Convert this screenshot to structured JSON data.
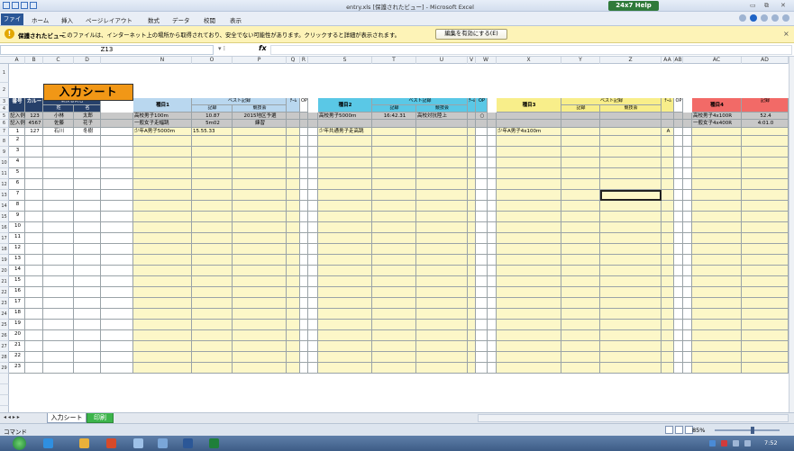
{
  "window": {
    "title": "entry.xls [保護されたビュー] - Microsoft Excel",
    "help_button": "24x7 Help",
    "ctl_min": "▭",
    "ctl_max": "⧉",
    "ctl_close": "✕"
  },
  "ribbon": {
    "file_tab": "ファイル",
    "tabs": [
      "ホーム",
      "挿入",
      "ページレイアウト",
      "数式",
      "データ",
      "校閲",
      "表示"
    ]
  },
  "infobar": {
    "title": "保護されたビュー",
    "message": "このファイルは、インターネット上の場所から取得されており、安全でない可能性があります。クリックすると詳細が表示されます。",
    "button": "編集を有効にする(E)",
    "close": "×"
  },
  "formula_bar": {
    "name_box": "Z13",
    "fx": "fx",
    "value": ""
  },
  "sheet": {
    "columns": [
      "A",
      "B",
      "C",
      "D",
      "N",
      "O",
      "P",
      "Q",
      "R",
      "S",
      "T",
      "U",
      "V",
      "W",
      "X",
      "Y",
      "Z",
      "AA",
      "AB",
      "AC",
      "AD"
    ],
    "rows": [
      "1",
      "2",
      "3",
      "4",
      "5",
      "6",
      "7",
      "8",
      "9",
      "10",
      "11",
      "12",
      "13",
      "14",
      "15",
      "16",
      "17",
      "18",
      "19",
      "20",
      "21",
      "22",
      "23",
      "24",
      "25",
      "26",
      "27",
      "28",
      "29"
    ],
    "title": "入力シート",
    "header": {
      "no": "番号",
      "card": "カルー",
      "name_top": "競技者氏名",
      "sei": "姓",
      "mei": "名",
      "event1": "種目1",
      "event2": "種目2",
      "event3": "種目3",
      "event4": "種目4",
      "best": "ベスト記録",
      "record": "記録",
      "meet": "競技会",
      "team": "ﾁｰﾑ",
      "op": "OP"
    },
    "example_rows": [
      {
        "no": "記入例",
        "card": "123",
        "sei": "小林",
        "mei": "太郎",
        "e1": "高校男子100m",
        "r1": "10.87",
        "m1": "2015地区予選",
        "e2": "高校男子5000m",
        "r2": "16:42.31",
        "m2": "高校対抗陸上",
        "w": "○",
        "e4": "高校男子4x100R",
        "r4": "52.4"
      },
      {
        "no": "記入例",
        "card": "4567",
        "sei": "佐藤",
        "mei": "花子",
        "e1": "一般女子走幅跳",
        "r1": "5m02",
        "m1": "練習",
        "e2": "",
        "r2": "",
        "m2": "",
        "w": "",
        "e4": "一般女子4x400R",
        "r4": "4:01.0"
      },
      {
        "no": "1",
        "card": "127",
        "sei": "石川",
        "mei": "冬樹",
        "e1": "少年A男子5000m",
        "r1": "15.55.33",
        "m1": "",
        "e2": "少年共通男子走高跳",
        "r2": "",
        "m2": "",
        "x": "少年A男子4x100m",
        "aa": "A",
        "e4": "",
        "r4": ""
      }
    ],
    "numbers": [
      "2",
      "3",
      "4",
      "5",
      "6",
      "7",
      "8",
      "9",
      "10",
      "11",
      "12",
      "13",
      "14",
      "15",
      "16",
      "17",
      "18",
      "19",
      "20",
      "21",
      "22",
      "23"
    ]
  },
  "tabs": {
    "sheet1": "入力シート",
    "sheet2": "印刷",
    "nav": "◂ ◂ ▸ ▸"
  },
  "status": {
    "mode": "コマンド",
    "zoom": "85%"
  },
  "taskbar": {
    "clock": "7:52"
  },
  "colors": {
    "event1": "#b9d7ef",
    "event2": "#5ac8e6",
    "event3": "#f8ee8a",
    "event4": "#f26a67",
    "input_yellow": "#fcf7c8",
    "header_dark": "#26406a"
  }
}
